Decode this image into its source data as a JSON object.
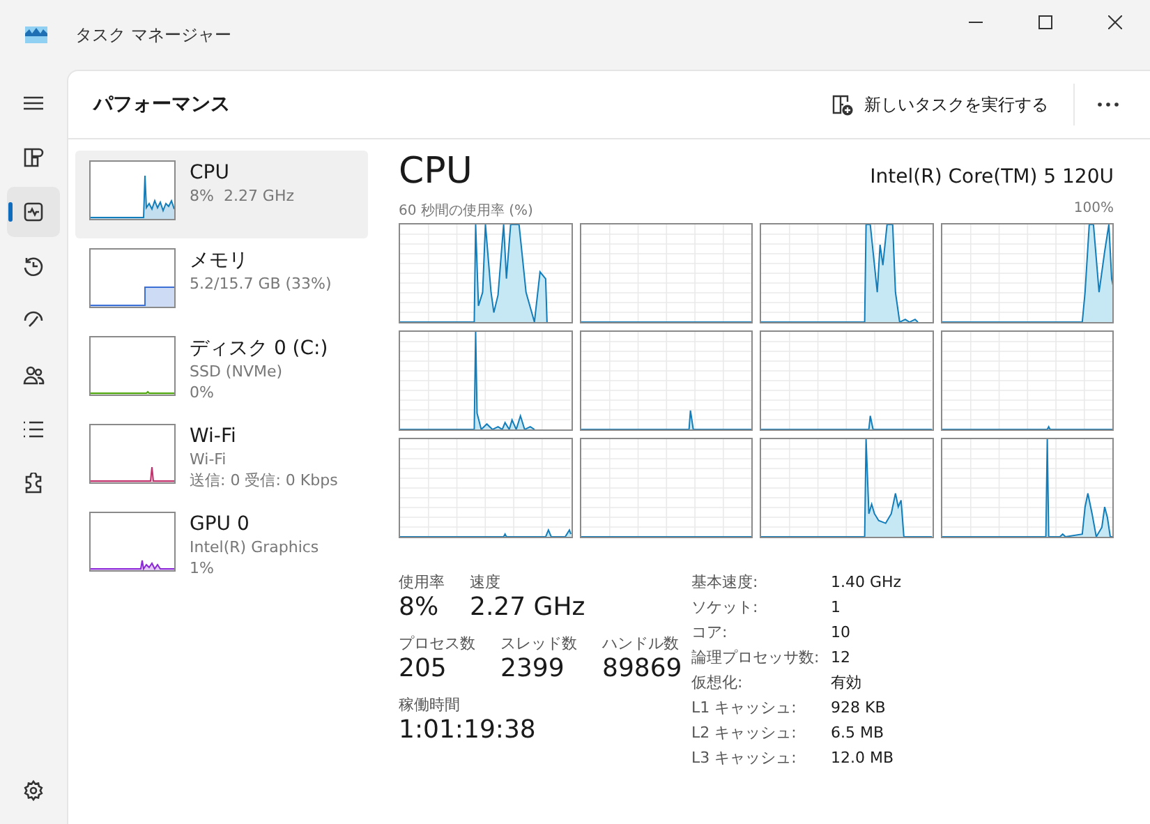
{
  "window": {
    "title": "タスク マネージャー"
  },
  "nav": [
    {
      "kind": "menu",
      "selected": false
    },
    {
      "kind": "processes",
      "selected": false
    },
    {
      "kind": "performance",
      "selected": true
    },
    {
      "kind": "history",
      "selected": false
    },
    {
      "kind": "startup",
      "selected": false
    },
    {
      "kind": "users",
      "selected": false
    },
    {
      "kind": "details",
      "selected": false
    },
    {
      "kind": "services",
      "selected": false
    },
    {
      "kind": "settings",
      "selected": false
    }
  ],
  "header": {
    "title": "パフォーマンス",
    "run_task": "新しいタスクを実行する"
  },
  "devices": [
    {
      "name": "CPU",
      "lines": [
        "8%  2.27 GHz"
      ],
      "selected": true,
      "color": "#117dbb",
      "kind": "cpu"
    },
    {
      "name": "メモリ",
      "lines": [
        "5.2/15.7 GB (33%)"
      ],
      "selected": false,
      "color": "#3c6fd6",
      "kind": "memory"
    },
    {
      "name": "ディスク 0 (C:)",
      "lines": [
        "SSD (NVMe)",
        "0%"
      ],
      "selected": false,
      "color": "#4da60c",
      "kind": "disk"
    },
    {
      "name": "Wi-Fi",
      "lines": [
        "Wi-Fi",
        "送信: 0 受信: 0 Kbps"
      ],
      "selected": false,
      "color": "#c0306a",
      "kind": "wifi"
    },
    {
      "name": "GPU 0",
      "lines": [
        "Intel(R) Graphics",
        "1%"
      ],
      "selected": false,
      "color": "#8b27d7",
      "kind": "gpu"
    }
  ],
  "detail": {
    "title": "CPU",
    "model": "Intel(R) Core(TM) 5 120U",
    "graph_caption": "60 秒間の使用率 (%)",
    "graph_max": "100%",
    "stats": [
      [
        {
          "label": "使用率",
          "value": "8%"
        },
        {
          "label": "速度",
          "value": "2.27 GHz"
        }
      ],
      [
        {
          "label": "プロセス数",
          "value": "205"
        },
        {
          "label": "スレッド数",
          "value": "2399"
        },
        {
          "label": "ハンドル数",
          "value": "89869"
        }
      ],
      [
        {
          "label": "稼働時間",
          "value": "1:01:19:38"
        }
      ]
    ],
    "specs": [
      {
        "label": "基本速度:",
        "value": "1.40 GHz"
      },
      {
        "label": "ソケット:",
        "value": "1"
      },
      {
        "label": "コア:",
        "value": "10"
      },
      {
        "label": "論理プロセッサ数:",
        "value": "12"
      },
      {
        "label": "仮想化:",
        "value": "有効"
      },
      {
        "label": "L1 キャッシュ:",
        "value": "928 KB"
      },
      {
        "label": "L2 キャッシュ:",
        "value": "6.5 MB"
      },
      {
        "label": "L3 キャッシュ:",
        "value": "12.0 MB"
      }
    ]
  }
}
